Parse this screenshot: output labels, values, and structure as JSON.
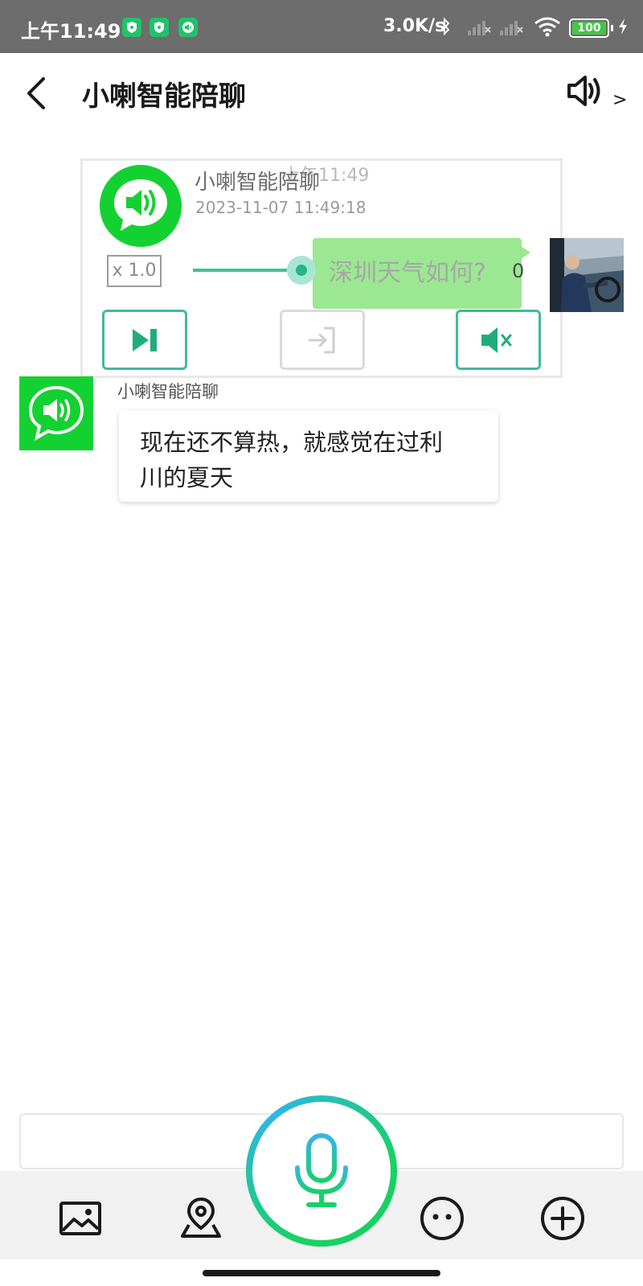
{
  "status_bar": {
    "time": "上午11:49",
    "network_speed": "3.0K/s",
    "battery": "100",
    "icons": [
      "shield-icon",
      "shield-icon",
      "speaker-chat-icon",
      "bluetooth-icon",
      "signal-icon",
      "signal-icon",
      "wifi-icon",
      "battery-icon",
      "charging-icon"
    ]
  },
  "header": {
    "title": "小喇智能陪聊",
    "back_icon": "chevron-left-icon",
    "speaker_icon": "speaker-icon",
    "speaker_chevron": ">"
  },
  "player": {
    "name": "小喇智能陪聊",
    "ghost_time": "上午11:49",
    "date": "2023-11-07 11:49:18",
    "speed": "x 1.0",
    "progress": 0.3,
    "count": "0",
    "buttons": [
      {
        "icon": "skip-next-icon",
        "enabled": true
      },
      {
        "icon": "sign-in-icon",
        "enabled": false
      },
      {
        "icon": "mute-icon",
        "enabled": true
      }
    ]
  },
  "messages": [
    {
      "sender": "user",
      "text": "深圳天气如何?"
    },
    {
      "sender": "bot",
      "name": "小喇智能陪聊",
      "text_line1": "现在还不算热，就感觉在过利",
      "text_line2": "川的夏天"
    }
  ],
  "input": {
    "placeholder": ""
  },
  "toolbar": {
    "icons": [
      "image-icon",
      "location-icon",
      "microphone-icon",
      "emoji-icon",
      "plus-icon"
    ]
  },
  "colors": {
    "accent_green": "#14d132",
    "teal": "#42b99a",
    "user_bubble": "#89e37f",
    "status_bar": "#6d6d6d"
  }
}
